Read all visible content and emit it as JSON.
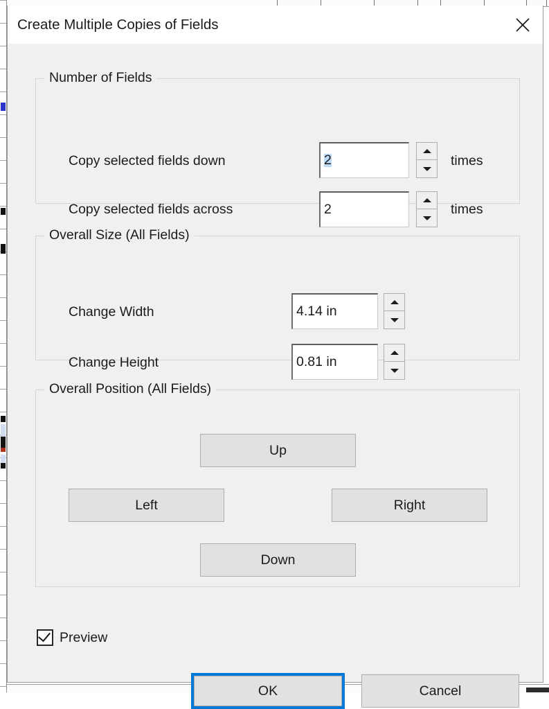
{
  "window": {
    "title": "Create Multiple Copies of Fields",
    "close_icon": "close-x-icon"
  },
  "groups": {
    "number_of_fields": {
      "legend": "Number of Fields",
      "rows": [
        {
          "label": "Copy selected fields down",
          "value": "2",
          "selected": true,
          "suffix": "times",
          "spin_up_icon": "triangle-up-icon",
          "spin_down_icon": "triangle-down-icon"
        },
        {
          "label": "Copy selected fields across",
          "value": "2",
          "selected": false,
          "suffix": "times",
          "spin_up_icon": "triangle-up-icon",
          "spin_down_icon": "triangle-down-icon"
        }
      ]
    },
    "overall_size": {
      "legend": "Overall Size (All Fields)",
      "rows": [
        {
          "label": "Change Width",
          "value": "4.14 in",
          "spin_up_icon": "triangle-up-icon",
          "spin_down_icon": "triangle-down-icon"
        },
        {
          "label": "Change Height",
          "value": "0.81 in",
          "spin_up_icon": "triangle-up-icon",
          "spin_down_icon": "triangle-down-icon"
        }
      ]
    },
    "overall_position": {
      "legend": "Overall Position (All Fields)",
      "buttons": {
        "up": "Up",
        "left": "Left",
        "right": "Right",
        "down": "Down"
      }
    }
  },
  "footer": {
    "preview_label": "Preview",
    "preview_checked": true,
    "ok_label": "OK",
    "cancel_label": "Cancel"
  },
  "colors": {
    "dialog_background": "#f0f0f0",
    "titlebar_background": "#ffffff",
    "focus_accent": "#0078d7",
    "text_selection": "#bcd9f5",
    "button_face": "#e1e1e1",
    "group_border": "#d4d4d4",
    "text": "#1b1b1b"
  }
}
